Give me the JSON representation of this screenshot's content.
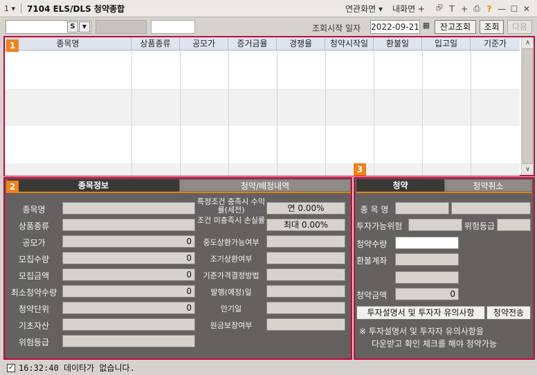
{
  "window": {
    "menu_glyph": "1 ▾",
    "title": "7104 ELS/DLS 청약종합",
    "links": [
      "연관화면 ▾",
      "내화면 +"
    ],
    "icons": [
      "window-link-icon",
      "text-icon",
      "plus-icon",
      "print-icon",
      "help-icon",
      "minimize-icon",
      "maximize-icon",
      "close-icon"
    ],
    "icon_glyphs": [
      "⮺",
      "T",
      "+",
      "⎙",
      "?",
      "—",
      "☐",
      "✕"
    ]
  },
  "toolbar": {
    "combo_s": "S",
    "combo_arrow": "▼",
    "date_label": "조회시작 일자",
    "date_value": "2022-09-21",
    "cal_glyph": "▦",
    "buttons": [
      "잔고조회",
      "조회",
      "다음"
    ]
  },
  "grid": {
    "badge": "1",
    "columns": [
      "종목명",
      "상품종류",
      "공모가",
      "증거금율",
      "경쟁율",
      "청약시작일",
      "환불일",
      "입고일",
      "기준가"
    ],
    "scroll_up": "∧",
    "scroll_down": "∨"
  },
  "info_panel": {
    "badge": "2",
    "tabs": [
      "종목정보",
      "청약/배정내역"
    ],
    "left_labels": [
      "종목명",
      "상품종류",
      "공모가",
      "모집수량",
      "모집금액",
      "최소청약수량",
      "청약단위",
      "기초자산",
      "위험등급"
    ],
    "left_values": [
      "",
      "",
      "0",
      "0",
      "0",
      "0",
      "0",
      "",
      ""
    ],
    "right_labels": [
      "특정조건 충족시 수익률(세전)",
      "조건 미충족시 손실률",
      "중도상환가능여부",
      "조기상환여부",
      "기준가격결정방법",
      "발행(예정)일",
      "만기일",
      "원금보장여부"
    ],
    "right_values": [
      "연 0.00%",
      "최대 0.00%",
      "",
      "",
      "",
      "",
      "",
      ""
    ]
  },
  "order_panel": {
    "badge": "3",
    "tabs": [
      "청약",
      "청약취소"
    ],
    "labels": [
      "종 목 명",
      "투자가능위험",
      "위험등급",
      "청약수량",
      "환불계좌",
      "청약금액"
    ],
    "amount_value": "0",
    "buttons": [
      "투자설명서 및 투자자 유의사항",
      "청약전송"
    ],
    "notice_line1": "※ 투자설명서 및 투자자 유의사항을",
    "notice_line2": "다운받고 확인 체크를 해야 청약가능"
  },
  "status": {
    "check": "✓",
    "text": "16:32:40  데이타가 없습니다."
  }
}
